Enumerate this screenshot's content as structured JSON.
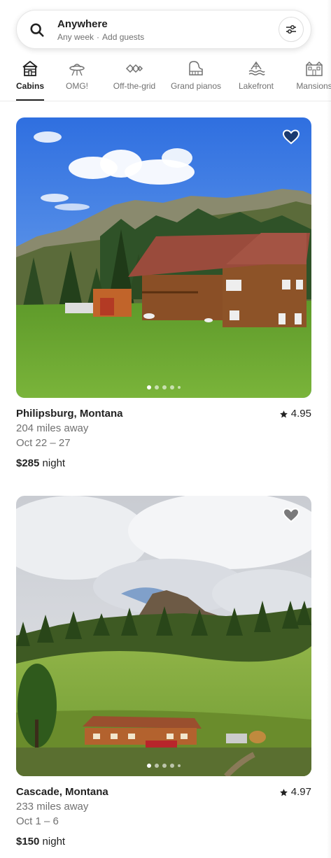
{
  "search": {
    "title": "Anywhere",
    "week": "Any week",
    "separator": "·",
    "guests": "Add guests"
  },
  "categories": [
    {
      "label": "Cabins",
      "icon": "cabin-icon",
      "active": true
    },
    {
      "label": "OMG!",
      "icon": "ufo-icon",
      "active": false
    },
    {
      "label": "Off-the-grid",
      "icon": "off-grid-icon",
      "active": false
    },
    {
      "label": "Grand pianos",
      "icon": "piano-icon",
      "active": false
    },
    {
      "label": "Lakefront",
      "icon": "lake-icon",
      "active": false
    },
    {
      "label": "Mansions",
      "icon": "mansion-icon",
      "active": false
    }
  ],
  "listings": [
    {
      "location": "Philipsburg, Montana",
      "rating": "4.95",
      "distance": "204 miles away",
      "dates": "Oct 22 – 27",
      "price": "$285",
      "price_unit": "night",
      "favorited": true
    },
    {
      "location": "Cascade, Montana",
      "rating": "4.97",
      "distance": "233 miles away",
      "dates": "Oct 1 – 6",
      "price": "$150",
      "price_unit": "night",
      "favorited": false
    }
  ],
  "colors": {
    "text": "#222222",
    "muted": "#717171",
    "border": "#dddddd"
  }
}
